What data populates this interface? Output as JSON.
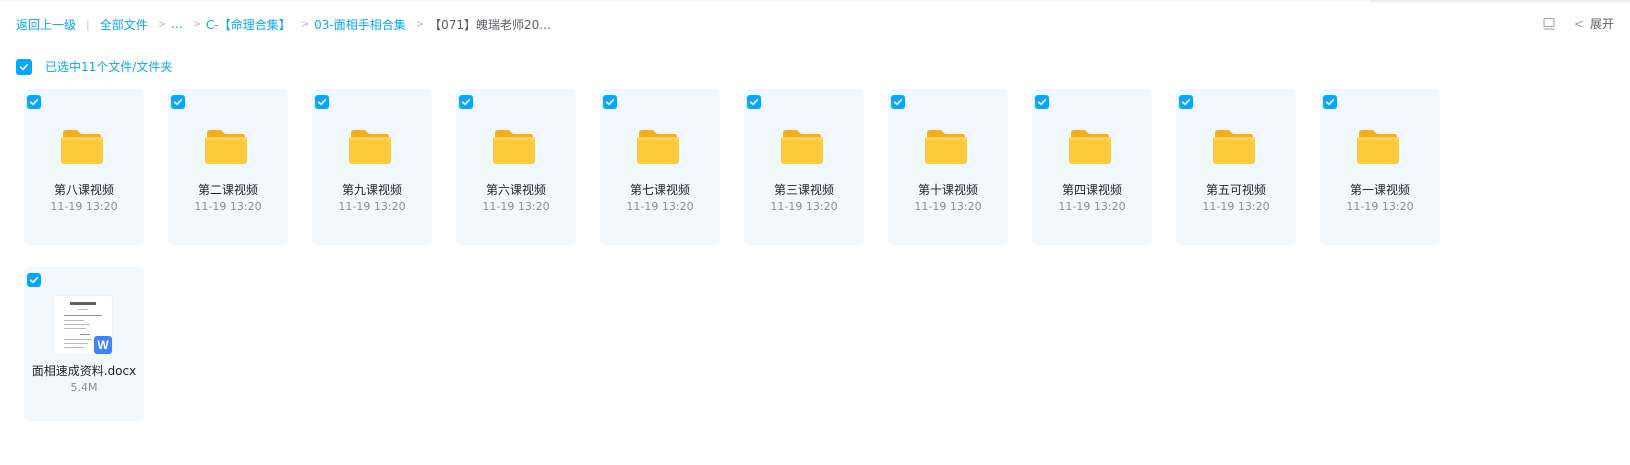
{
  "breadcrumb": {
    "back": "返回上一级",
    "all_files": "全部文件",
    "ellipsis": "...",
    "crumb1": "C-【命理合集】",
    "crumb2": "03-面相手相合集",
    "current": "【071】魄瑞老师20..."
  },
  "tools": {
    "expand_label": "展开"
  },
  "selection": {
    "label": "已选中11个文件/文件夹"
  },
  "items": [
    {
      "name": "第八课视频",
      "meta": "11-19 13:20",
      "type": "folder"
    },
    {
      "name": "第二课视频",
      "meta": "11-19 13:20",
      "type": "folder"
    },
    {
      "name": "第九课视频",
      "meta": "11-19 13:20",
      "type": "folder"
    },
    {
      "name": "第六课视频",
      "meta": "11-19 13:20",
      "type": "folder"
    },
    {
      "name": "第七课视频",
      "meta": "11-19 13:20",
      "type": "folder"
    },
    {
      "name": "第三课视频",
      "meta": "11-19 13:20",
      "type": "folder"
    },
    {
      "name": "第十课视频",
      "meta": "11-19 13:20",
      "type": "folder"
    },
    {
      "name": "第四课视频",
      "meta": "11-19 13:20",
      "type": "folder"
    },
    {
      "name": "第五可视频",
      "meta": "11-19 13:20",
      "type": "folder"
    },
    {
      "name": "第一课视频",
      "meta": "11-19 13:20",
      "type": "folder"
    },
    {
      "name": "面相速成资料.docx",
      "meta": "5.4M",
      "type": "doc",
      "badge": "W"
    }
  ],
  "colors": {
    "accent": "#06a7ff",
    "card_bg": "#f0f8fd",
    "folder": "#ffc93c",
    "word": "#3f84f5"
  }
}
